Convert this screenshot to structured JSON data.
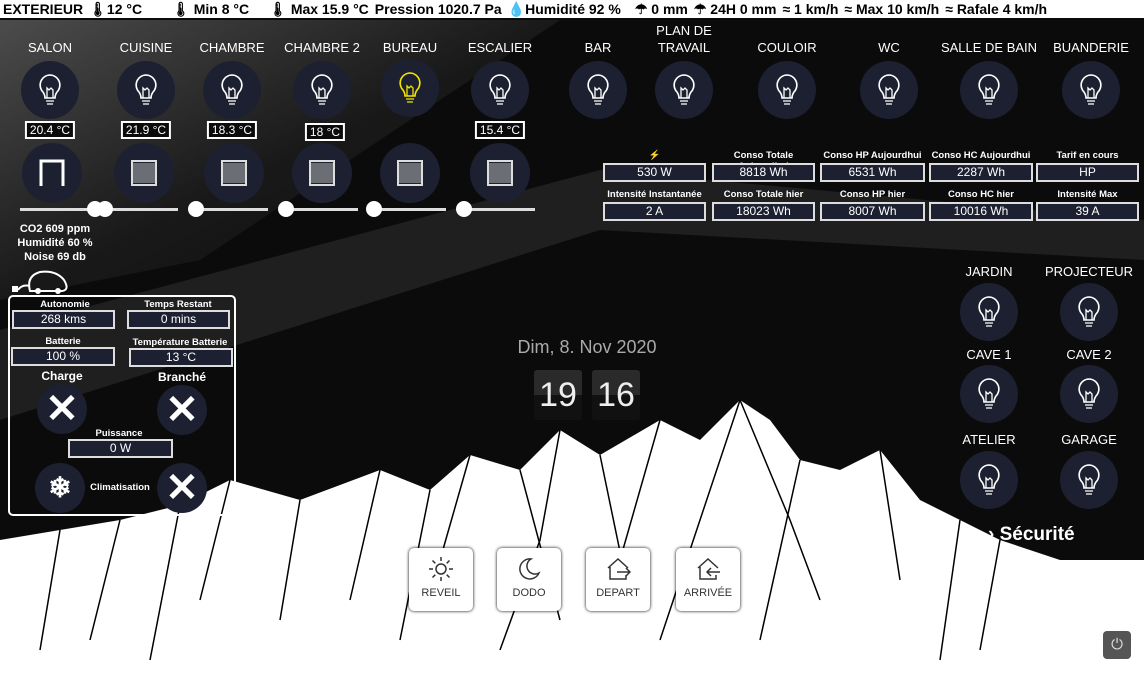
{
  "weather": [
    "EXTERIEUR",
    "12 °C",
    "Min 8 °C",
    "Max 15.9 °C",
    "Pression 1020.7 Pa",
    "Humidité 92 %",
    "0 mm",
    "24H 0 mm",
    "1 km/h",
    "Max 10 km/h",
    "Rafale 4 km/h"
  ],
  "rooms": [
    {
      "name": "SALON",
      "temp": "20.4 °C",
      "on": false
    },
    {
      "name": "CUISINE",
      "temp": "21.9 °C",
      "on": false
    },
    {
      "name": "CHAMBRE",
      "temp": "18.3 °C",
      "on": false
    },
    {
      "name": "CHAMBRE 2",
      "temp": "18 °C",
      "on": false
    },
    {
      "name": "BUREAU",
      "on": true
    },
    {
      "name": "ESCALIER",
      "temp": "15.4 °C",
      "on": false
    },
    {
      "name": "BAR",
      "on": false
    },
    {
      "name": "PLAN DE TRAVAIL",
      "on": false
    },
    {
      "name": "COULOIR",
      "on": false
    },
    {
      "name": "WC",
      "on": false
    },
    {
      "name": "SALLE DE BAIN",
      "on": false
    },
    {
      "name": "BUANDERIE",
      "on": false
    }
  ],
  "shutters": [
    {
      "state": "open",
      "level": 100
    },
    {
      "state": "closed",
      "level": 0
    },
    {
      "state": "closed",
      "level": 0
    },
    {
      "state": "closed",
      "level": 0
    },
    {
      "state": "closed",
      "level": 0
    },
    {
      "state": "closed",
      "level": 0
    }
  ],
  "air": {
    "co2": "CO2 609 ppm",
    "humidity": "Humidité 60 %",
    "noise": "Noise 69 db"
  },
  "energy": {
    "row1": [
      {
        "label": "⚡",
        "value": "530 W"
      },
      {
        "label": "Conso Totale Aujourdhui",
        "value": "8818 Wh"
      },
      {
        "label": "Conso HP Aujourdhui",
        "value": "6531 Wh"
      },
      {
        "label": "Conso HC Aujourdhui",
        "value": "2287 Wh"
      },
      {
        "label": "Tarif en cours",
        "value": "HP"
      }
    ],
    "row2": [
      {
        "label": "Intensité Instantanée",
        "value": "2 A"
      },
      {
        "label": "Conso Totale hier",
        "value": "18023 Wh"
      },
      {
        "label": "Conso HP hier",
        "value": "8007 Wh"
      },
      {
        "label": "Conso HC hier",
        "value": "10016 Wh"
      },
      {
        "label": "Intensité Max",
        "value": "39 A"
      }
    ]
  },
  "car": {
    "autonomie_label": "Autonomie",
    "autonomie": "268 kms",
    "temps_label": "Temps Restant",
    "temps": "0 mins",
    "batterie_label": "Batterie",
    "batterie": "100 %",
    "tempbat_label": "Température Batterie",
    "tempbat": "13 °C",
    "charge_label": "Charge",
    "branche_label": "Branché",
    "puissance_label": "Puissance",
    "puissance": "0 W",
    "clim_label": "Climatisation"
  },
  "outdoor": [
    {
      "name": "JARDIN"
    },
    {
      "name": "PROJECTEUR"
    },
    {
      "name": "CAVE 1"
    },
    {
      "name": "CAVE 2"
    },
    {
      "name": "ATELIER"
    },
    {
      "name": "GARAGE"
    }
  ],
  "date": "Dim, 8. Nov 2020",
  "clock": {
    "hours": "19",
    "minutes": "16"
  },
  "security_label": "Sécurité",
  "scenes": [
    {
      "label": "REVEIL"
    },
    {
      "label": "DODO"
    },
    {
      "label": "DEPART"
    },
    {
      "label": "ARRIVÉE"
    }
  ],
  "colors": {
    "panel": "#1c2030",
    "bulb_on": "#f2e200"
  }
}
